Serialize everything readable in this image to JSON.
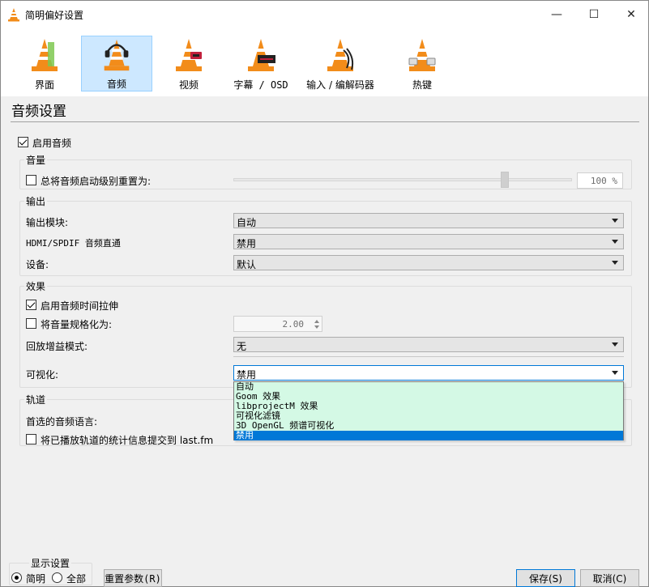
{
  "window": {
    "title": "简明偏好设置",
    "controls": [
      "—",
      "☐",
      "✕"
    ]
  },
  "categories": [
    {
      "label": "界面",
      "selected": false
    },
    {
      "label": "音频",
      "selected": true
    },
    {
      "label": "视频",
      "selected": false
    },
    {
      "label": "字幕 / OSD",
      "selected": false
    },
    {
      "label": "输入 / 编解码器",
      "selected": false
    },
    {
      "label": "热键",
      "selected": false
    }
  ],
  "panel": {
    "title": "音频设置",
    "enable_audio_label": "启用音频",
    "enable_audio_checked": true
  },
  "volume_group": {
    "title": "音量",
    "reset_label": "总将音频启动级别重置为:",
    "reset_checked": false,
    "volume_level_pct": 80,
    "volume_value": "100 %"
  },
  "output_group": {
    "title": "输出",
    "module_label": "输出模块:",
    "module_value": "自动",
    "hdmi_label": "HDMI/SPDIF 音频直通",
    "hdmi_value": "禁用",
    "device_label": "设备:",
    "device_value": "默认"
  },
  "effects_group": {
    "title": "效果",
    "stretch_label": "启用音频时间拉伸",
    "stretch_checked": true,
    "normalize_label": "将音量规格化为:",
    "normalize_checked": false,
    "normalize_value": "2.00",
    "replay_label": "回放增益模式:",
    "replay_value": "无",
    "visual_label": "可视化:",
    "visual_value": "禁用",
    "visual_options": [
      "自动",
      "Goom 效果",
      "libprojectM 效果",
      "可视化滤镜",
      "3D OpenGL 频谱可视化",
      "禁用"
    ],
    "visual_selected_index": 5
  },
  "tracks_group": {
    "title": "轨道",
    "lang_label": "首选的音频语言:",
    "lastfm_label": "将已播放轨道的统计信息提交到 last.fm",
    "lastfm_checked": false
  },
  "footer": {
    "display_title": "显示设置",
    "simple_label": "简明",
    "simple_checked": true,
    "all_label": "全部",
    "all_checked": false,
    "reset_button": "重置参数(R)",
    "save_button": "保存(S)",
    "cancel_button": "取消(C)"
  },
  "colors": {
    "accent": "#0078d7",
    "cone_orange": "#f28c1a",
    "dropdown_bg": "#d4f9e5",
    "selected_category": "#cde8ff"
  }
}
